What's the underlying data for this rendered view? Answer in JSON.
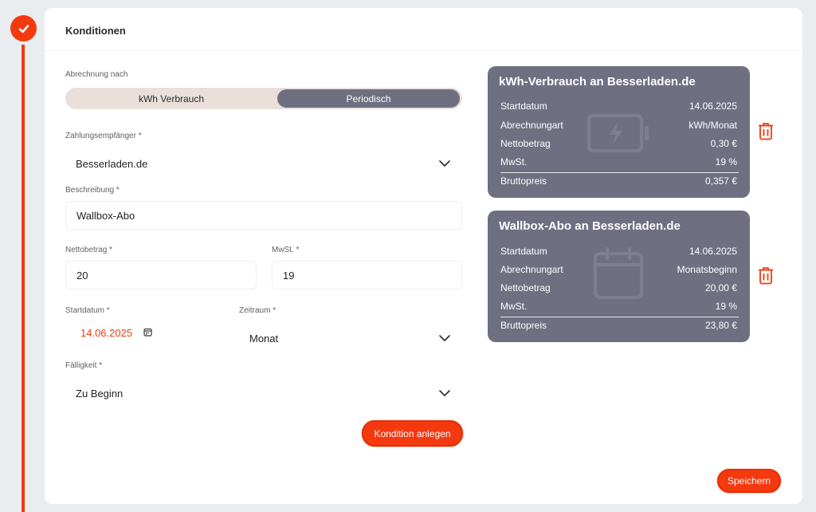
{
  "section": {
    "title": "Konditionen"
  },
  "form": {
    "billing_label": "Abrechnung nach",
    "toggle": {
      "left": "kWh Verbrauch",
      "right": "Periodisch",
      "selected": "Periodisch"
    },
    "payee": {
      "label": "Zahlungsempfänger *",
      "value": "Besserladen.de"
    },
    "description": {
      "label": "Beschreibung *",
      "value": "Wallbox-Abo"
    },
    "net": {
      "label": "Nettobetrag *",
      "value": "20"
    },
    "vat": {
      "label": "MwSt. *",
      "value": "19"
    },
    "start": {
      "label": "Startdatum *",
      "value": "14.06.2025"
    },
    "period": {
      "label": "Zeitraum *",
      "value": "Monat"
    },
    "due": {
      "label": "Fälligkeit *",
      "value": "Zu Beginn"
    },
    "create_button": "Kondition anlegen"
  },
  "summaries": [
    {
      "title": "kWh-Verbrauch an Besserladen.de",
      "rows": [
        {
          "label": "Startdatum",
          "value": "14.06.2025"
        },
        {
          "label": "Abrechnungart",
          "value": "kWh/Monat"
        },
        {
          "label": "Nettobetrag",
          "value": "0,30 €"
        },
        {
          "label": "MwSt.",
          "value": "19 %"
        }
      ],
      "total": {
        "label": "Bruttopreis",
        "value": "0,357 €"
      },
      "icon": "battery-charging-icon"
    },
    {
      "title": "Wallbox-Abo an Besserladen.de",
      "rows": [
        {
          "label": "Startdatum",
          "value": "14.06.2025"
        },
        {
          "label": "Abrechnungart",
          "value": "Monatsbeginn"
        },
        {
          "label": "Nettobetrag",
          "value": "20,00 €"
        },
        {
          "label": "MwSt.",
          "value": "19 %"
        }
      ],
      "total": {
        "label": "Bruttopreis",
        "value": "23,80 €"
      },
      "icon": "calendar-icon"
    }
  ],
  "save_button": "Speichern",
  "colors": {
    "accent": "#f4390f",
    "summary_bg": "#6f6f82",
    "toggle_bg": "#eadfdb"
  }
}
